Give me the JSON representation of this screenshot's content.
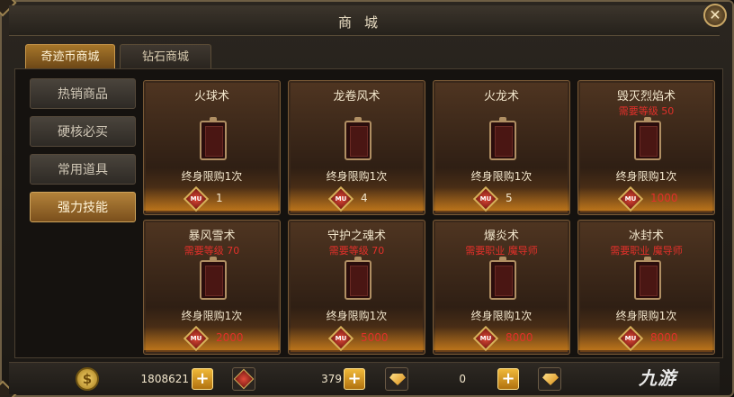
{
  "window": {
    "title": "商城",
    "close_label": "✕"
  },
  "tabs": [
    {
      "label": "奇迹币商城",
      "active": true
    },
    {
      "label": "钻石商城",
      "active": false
    }
  ],
  "categories": [
    {
      "label": "热销商品",
      "active": false
    },
    {
      "label": "硬核必买",
      "active": false
    },
    {
      "label": "常用道具",
      "active": false
    },
    {
      "label": "强力技能",
      "active": true
    }
  ],
  "items": [
    {
      "name": "火球术",
      "requirement": "",
      "limit": "终身限购1次",
      "price": "1",
      "affordable": true,
      "currency_badge": "MU"
    },
    {
      "name": "龙卷风术",
      "requirement": "",
      "limit": "终身限购1次",
      "price": "4",
      "affordable": true,
      "currency_badge": "MU"
    },
    {
      "name": "火龙术",
      "requirement": "",
      "limit": "终身限购1次",
      "price": "5",
      "affordable": true,
      "currency_badge": "MU"
    },
    {
      "name": "毁灭烈焰术",
      "requirement": "需要等级 50",
      "limit": "终身限购1次",
      "price": "1000",
      "affordable": false,
      "currency_badge": "MU"
    },
    {
      "name": "暴风雪术",
      "requirement": "需要等级 70",
      "limit": "终身限购1次",
      "price": "2000",
      "affordable": false,
      "currency_badge": "MU"
    },
    {
      "name": "守护之魂术",
      "requirement": "需要等级 70",
      "limit": "终身限购1次",
      "price": "5000",
      "affordable": false,
      "currency_badge": "MU"
    },
    {
      "name": "爆炎术",
      "requirement": "需要职业 魔导师",
      "limit": "终身限购1次",
      "price": "8000",
      "affordable": false,
      "currency_badge": "MU"
    },
    {
      "name": "冰封术",
      "requirement": "需要职业 魔导师",
      "limit": "终身限购1次",
      "price": "8000",
      "affordable": false,
      "currency_badge": "MU"
    }
  ],
  "currencies": {
    "gold": {
      "icon": "gold-coin-icon",
      "symbol": "$",
      "value": "1808621"
    },
    "miracle": {
      "icon": "mu-badge-icon",
      "value": "379"
    },
    "diamond": {
      "icon": "diamond-icon",
      "value": "0"
    },
    "plus_label": "+"
  },
  "watermark": "九游",
  "colors": {
    "accent": "#b3823a",
    "warning": "#e2302a",
    "text": "#f2e6cc"
  }
}
